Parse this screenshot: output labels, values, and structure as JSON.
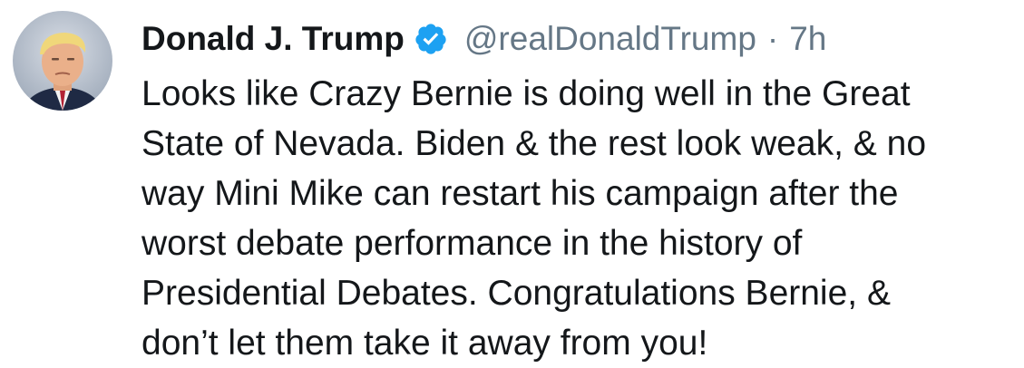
{
  "tweet": {
    "author": {
      "display_name": "Donald J. Trump",
      "handle": "@realDonaldTrump",
      "verified_icon": "verified-badge-icon",
      "avatar_icon": "profile-avatar"
    },
    "separator": "·",
    "time_ago": "7h",
    "body_lines": [
      "Looks like Crazy Bernie is doing well in the Great",
      "State of Nevada. Biden & the rest look weak, & no",
      "way Mini Mike can restart his campaign after the",
      "worst debate performance in the history of",
      "Presidential Debates. Congratulations Bernie, &",
      "don’t let them take it away from you!"
    ]
  },
  "colors": {
    "name_text": "#14171a",
    "secondary_text": "#657786",
    "verified_blue": "#1da1f2"
  }
}
